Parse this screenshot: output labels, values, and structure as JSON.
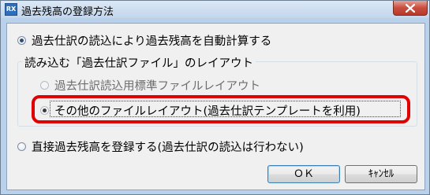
{
  "window": {
    "title": "過去残高の登録方法",
    "app_icon_text": "RX"
  },
  "options": {
    "auto_calc_label": "過去仕訳の読込により過去残高を自動計算する",
    "layout_group_label": "読み込む「過去仕訳ファイル」のレイアウト",
    "standard_layout_label": "過去仕訳読込用標準ファイルレイアウト",
    "other_layout_label": "その他のファイルレイアウト(過去仕訳テンプレートを利用)",
    "direct_register_label": "直接過去残高を登録する(過去仕訳の読込は行わない)"
  },
  "buttons": {
    "ok_label": "ＯＫ",
    "cancel_label": "ｷｬﾝｾﾙ"
  },
  "colors": {
    "highlight": "#e00000",
    "titlebar": "#c3d6ec",
    "close_button": "#c74e3f"
  },
  "icons": {
    "close": "close-icon",
    "app": "app-icon"
  }
}
